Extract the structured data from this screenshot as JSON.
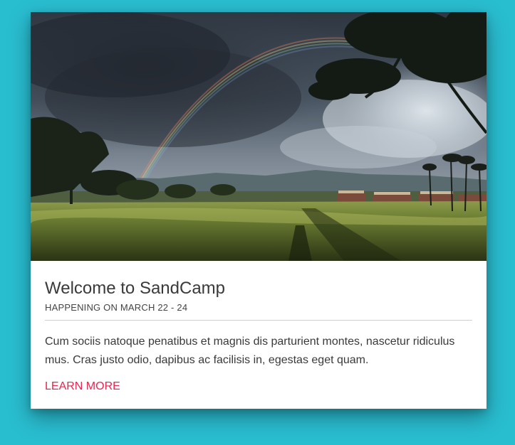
{
  "card": {
    "image_alt": "Rainbow over a golf course with palm trees",
    "title": "Welcome to SandCamp",
    "subtitle": "HAPPENING ON MARCH 22 - 24",
    "body": "Cum sociis natoque penatibus et magnis dis parturient montes, nascetur ridiculus mus. Cras justo odio, dapibus ac facilisis in, egestas eget quam.",
    "action_label": "LEARN MORE"
  },
  "colors": {
    "page_background": "#29bdd0",
    "card_background": "#ffffff",
    "action": "#e8264f",
    "title_text": "#3a3a3a"
  }
}
